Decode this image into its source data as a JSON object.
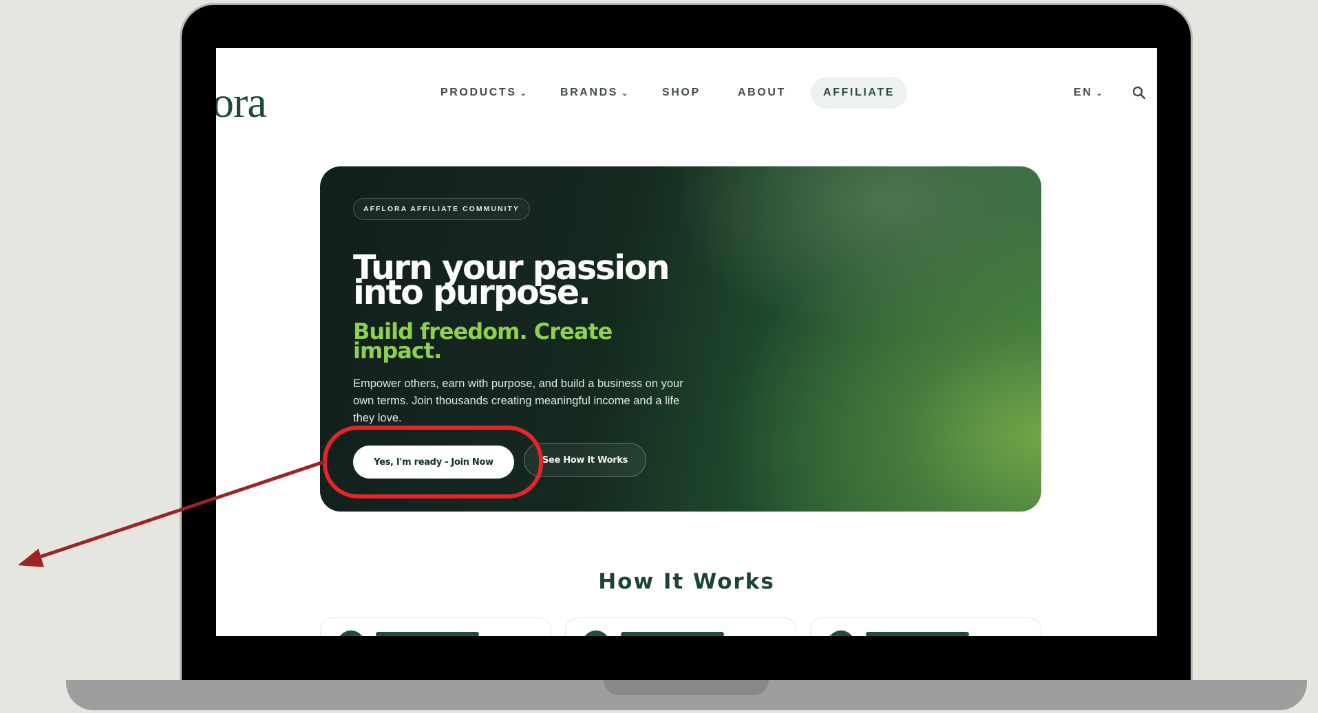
{
  "nav": {
    "logo_text": "ora",
    "products": "PRODUCTS",
    "brands": "BRANDS",
    "shop": "SHOP",
    "about": "ABOUT",
    "affiliate": "AFFILIATE",
    "language": "EN",
    "dropdown_glyph": "⌄"
  },
  "hero": {
    "badge": "AFFLORA AFFILIATE COMMUNITY",
    "title": "Turn your passion into purpose.",
    "subtitle": "Build freedom. Create impact.",
    "description": "Empower others, earn with purpose, and build a business on your own terms. Join thousands creating meaningful income and a life they love.",
    "primary_button": "Yes, I'm ready - Join Now",
    "secondary_button": "See How It Works"
  },
  "section": {
    "title": "How It Works"
  },
  "icons": {
    "search": "search-icon",
    "chevron": "chevron-down-icon"
  },
  "colors": {
    "brand_green": "#1d4a3a",
    "accent_lime": "#8fd14f",
    "highlight_red": "#e4262b",
    "arrow_red": "#9b2424"
  }
}
